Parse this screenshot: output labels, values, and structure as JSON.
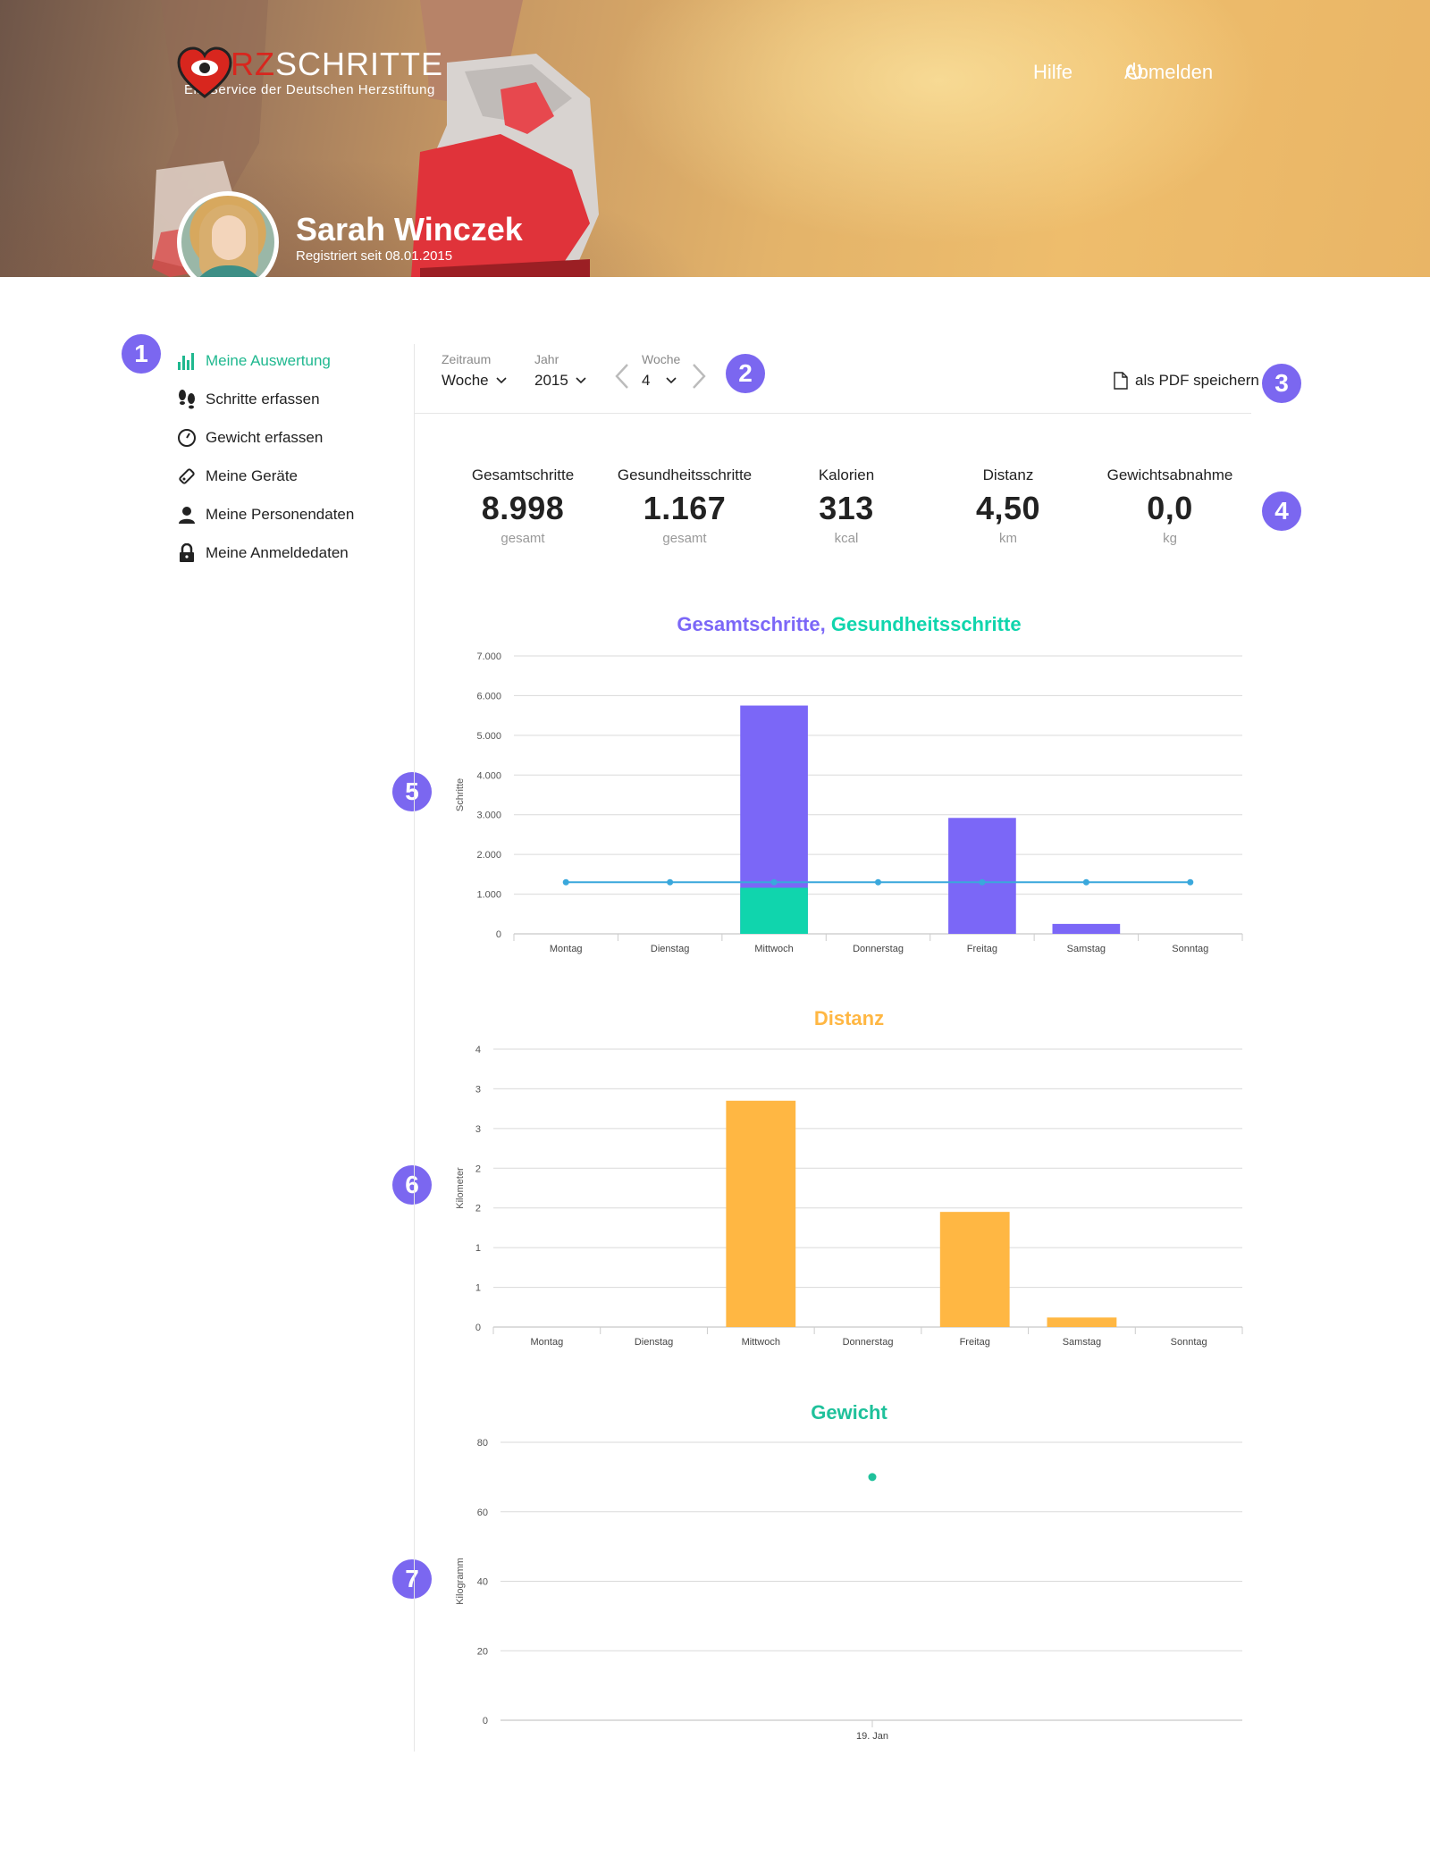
{
  "header": {
    "logo_word_red": "HERZ",
    "logo_word_white": "SCHRITTE",
    "logo_tagline": "Ein Service der Deutschen Herzstiftung",
    "help_label": "Hilfe",
    "logout_label": "Abmelden",
    "user_name": "Sarah Winczek",
    "registered": "Registriert seit 08.01.2015"
  },
  "badges": [
    "1",
    "2",
    "3",
    "4",
    "5",
    "6",
    "7"
  ],
  "sidebar": {
    "items": [
      {
        "label": "Meine Auswertung",
        "icon": "bar-chart-icon",
        "active": true
      },
      {
        "label": "Schritte erfassen",
        "icon": "footprints-icon",
        "active": false
      },
      {
        "label": "Gewicht erfassen",
        "icon": "gauge-icon",
        "active": false
      },
      {
        "label": "Meine Geräte",
        "icon": "device-icon",
        "active": false
      },
      {
        "label": "Meine Personendaten",
        "icon": "person-icon",
        "active": false
      },
      {
        "label": "Meine Anmeldedaten",
        "icon": "lock-icon",
        "active": false
      }
    ]
  },
  "filters": {
    "zeitraum_label": "Zeitraum",
    "zeitraum_value": "Woche",
    "jahr_label": "Jahr",
    "jahr_value": "2015",
    "woche_label": "Woche",
    "woche_value": "4",
    "pdf_label": "als PDF speichern"
  },
  "stats": [
    {
      "label": "Gesamtschritte",
      "value": "8.998",
      "unit": "gesamt"
    },
    {
      "label": "Gesundheitsschritte",
      "value": "1.167",
      "unit": "gesamt"
    },
    {
      "label": "Kalorien",
      "value": "313",
      "unit": "kcal"
    },
    {
      "label": "Distanz",
      "value": "4,50",
      "unit": "km"
    },
    {
      "label": "Gewichtsabnahme",
      "value": "0,0",
      "unit": "kg"
    }
  ],
  "colors": {
    "purple": "#7b67f7",
    "teal": "#10d5ad",
    "line": "#3aa8dc",
    "orange": "#ffb743",
    "green": "#1fc19b",
    "badge": "#7b67f0"
  },
  "chart_data": [
    {
      "type": "bar",
      "title_part1": "Gesamtschritte,",
      "title_part2": "Gesundheitsschritte",
      "ylabel": "Schritte",
      "ylim": [
        0,
        7000
      ],
      "yticks": [
        "0",
        "1.000",
        "2.000",
        "3.000",
        "4.000",
        "5.000",
        "6.000",
        "7.000"
      ],
      "categories": [
        "Montag",
        "Dienstag",
        "Mittwoch",
        "Donnerstag",
        "Freitag",
        "Samstag",
        "Sonntag"
      ],
      "series": [
        {
          "values": [
            0,
            0,
            5750,
            0,
            2920,
            250,
            0
          ]
        },
        {
          "values": [
            0,
            0,
            1160,
            0,
            0,
            0,
            0
          ]
        },
        {
          "type": "line",
          "values": [
            1300,
            1300,
            1300,
            1300,
            1300,
            1300,
            1300
          ]
        }
      ]
    },
    {
      "type": "bar",
      "title": "Distanz",
      "ylabel": "Kilometer",
      "ylim": [
        0,
        3.5
      ],
      "yticks": [
        "0",
        "1",
        "1",
        "2",
        "2",
        "3",
        "3",
        "4"
      ],
      "categories": [
        "Montag",
        "Dienstag",
        "Mittwoch",
        "Donnerstag",
        "Freitag",
        "Samstag",
        "Sonntag"
      ],
      "values": [
        0,
        0,
        2.85,
        0,
        1.45,
        0.12,
        0
      ]
    },
    {
      "type": "scatter",
      "title": "Gewicht",
      "ylabel": "Kilogramm",
      "ylim": [
        0,
        80
      ],
      "yticks": [
        "0",
        "20",
        "40",
        "60",
        "80"
      ],
      "categories": [
        "19. Jan"
      ],
      "values": [
        70
      ]
    }
  ]
}
